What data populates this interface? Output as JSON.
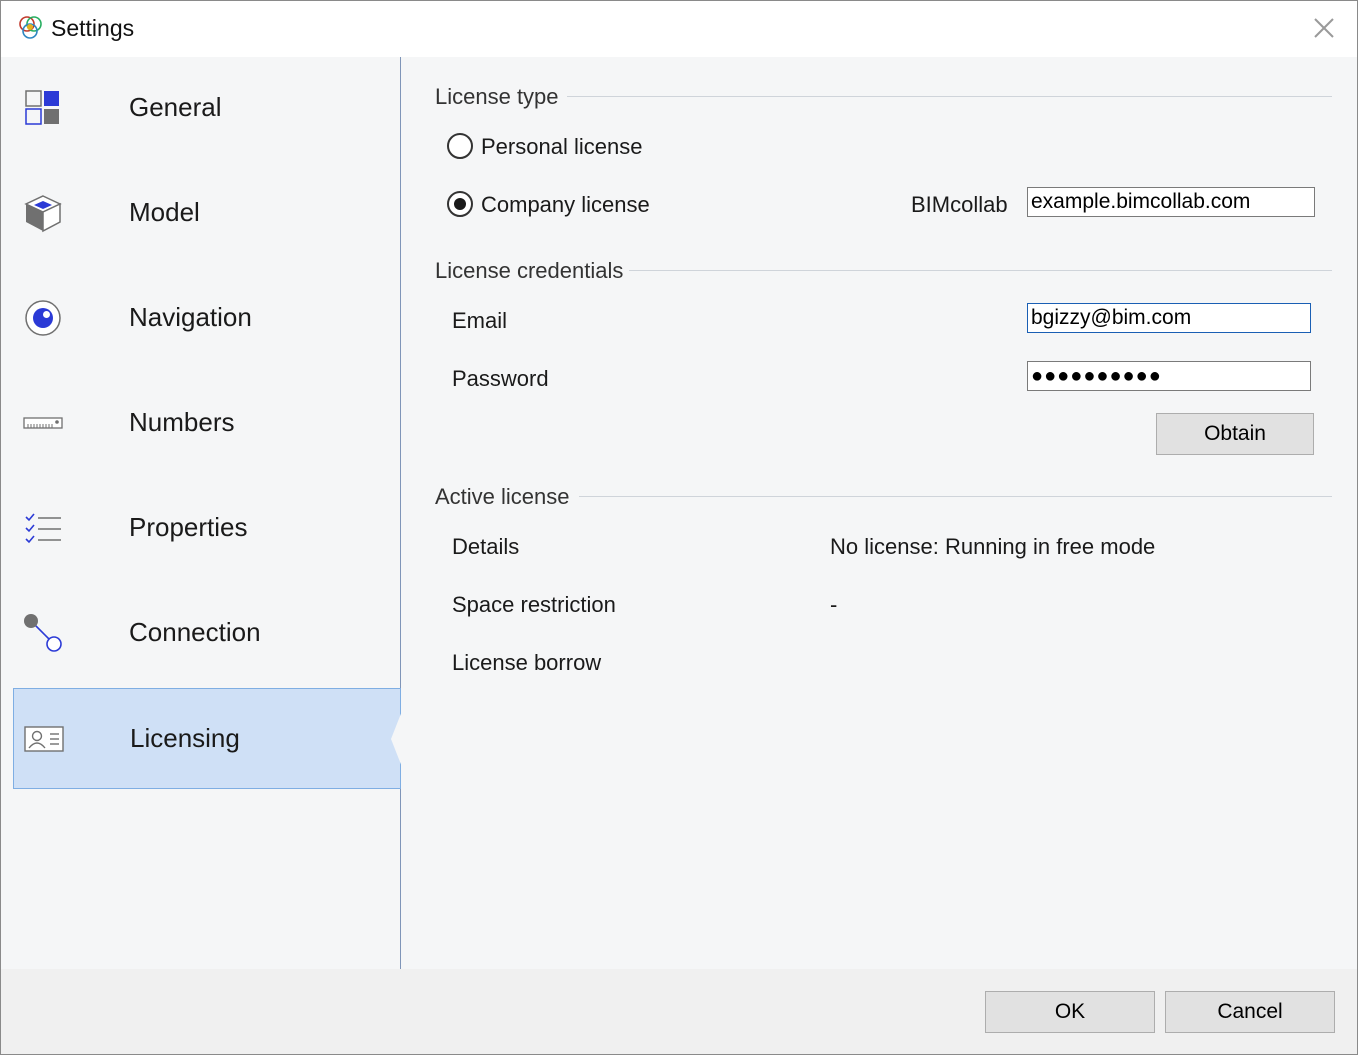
{
  "window": {
    "title": "Settings"
  },
  "sidebar": {
    "items": [
      {
        "label": "General",
        "icon": "grid-tiles-icon",
        "selected": false
      },
      {
        "label": "Model",
        "icon": "cube-icon",
        "selected": false
      },
      {
        "label": "Navigation",
        "icon": "eye-target-icon",
        "selected": false
      },
      {
        "label": "Numbers",
        "icon": "ruler-icon",
        "selected": false
      },
      {
        "label": "Properties",
        "icon": "checklist-icon",
        "selected": false
      },
      {
        "label": "Connection",
        "icon": "connection-nodes-icon",
        "selected": false
      },
      {
        "label": "Licensing",
        "icon": "id-card-icon",
        "selected": true
      }
    ]
  },
  "license_type": {
    "heading": "License type",
    "personal_label": "Personal license",
    "company_label": "Company license",
    "selected": "company",
    "server_label": "BIMcollab",
    "server_value": "example.bimcollab.com"
  },
  "credentials": {
    "heading": "License credentials",
    "email_label": "Email",
    "email_value": "bgizzy@bim.com",
    "password_label": "Password",
    "password_mask": "●●●●●●●●●●",
    "obtain_label": "Obtain"
  },
  "active_license": {
    "heading": "Active license",
    "details_label": "Details",
    "details_value": "No license: Running in free mode",
    "space_label": "Space restriction",
    "space_value": "-",
    "borrow_label": "License borrow"
  },
  "footer": {
    "ok_label": "OK",
    "cancel_label": "Cancel"
  },
  "colors": {
    "accent": "#2b3ad6",
    "selection": "#cfe0f6",
    "icon_gray": "#707070"
  }
}
